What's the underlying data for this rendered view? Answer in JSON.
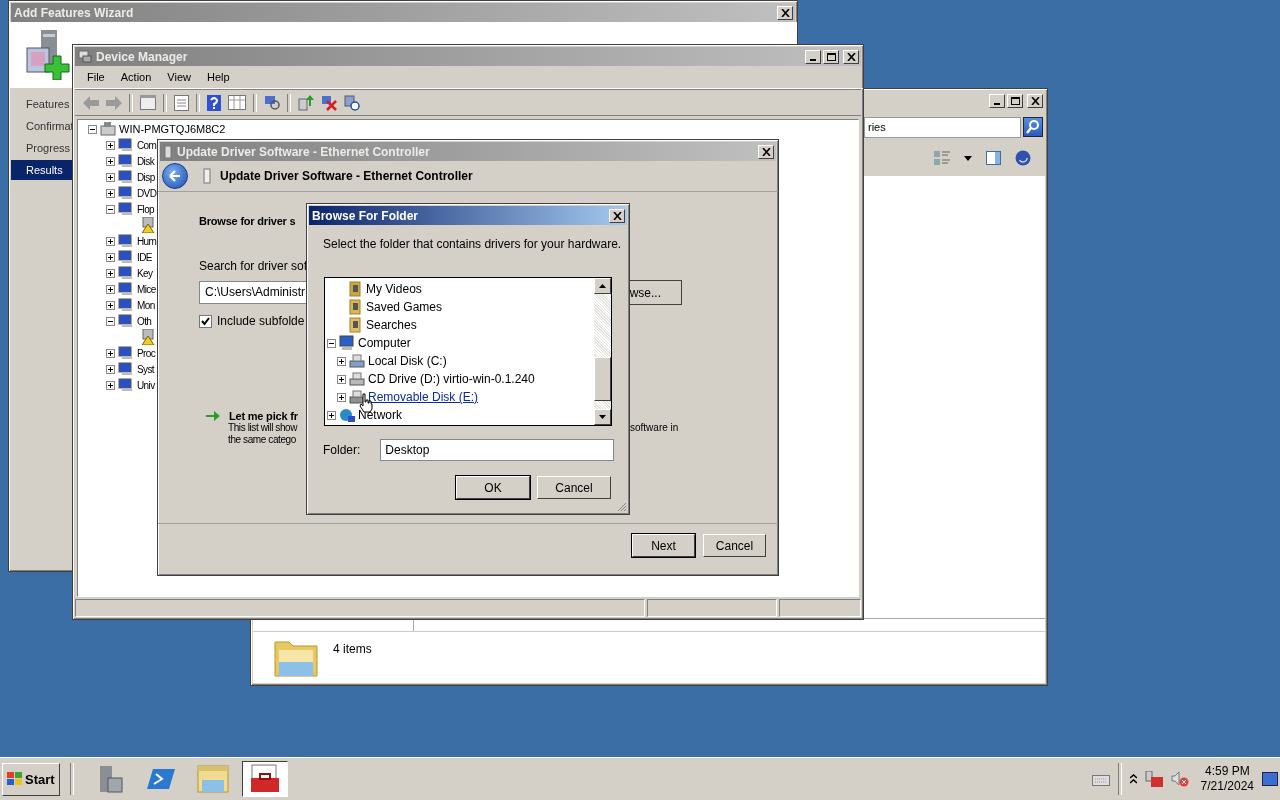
{
  "wizard": {
    "title": "Add Features Wizard",
    "steps": [
      {
        "label": "Features",
        "selected": false
      },
      {
        "label": "Confirmat",
        "selected": false
      },
      {
        "label": "Progress",
        "selected": false
      },
      {
        "label": "Results",
        "selected": true
      }
    ]
  },
  "explorer": {
    "search_value": "ries",
    "status": "4 items"
  },
  "device_manager": {
    "title": "Device Manager",
    "menu": [
      "File",
      "Action",
      "View",
      "Help"
    ],
    "tree": {
      "label": "WIN-PMGTQJ6M8C2",
      "expanded": true,
      "children": [
        {
          "label": "Com",
          "expanded": false
        },
        {
          "label": "Disk",
          "expanded": false
        },
        {
          "label": "Disp",
          "expanded": false
        },
        {
          "label": "DVD",
          "expanded": false
        },
        {
          "label": "Flop",
          "expanded": true,
          "children": [
            {
              "warning": true
            }
          ]
        },
        {
          "label": "Hum",
          "expanded": false
        },
        {
          "label": "IDE",
          "expanded": false
        },
        {
          "label": "Key",
          "expanded": false
        },
        {
          "label": "Mice",
          "expanded": false
        },
        {
          "label": "Mon",
          "expanded": false
        },
        {
          "label": "Oth",
          "expanded": true,
          "children": [
            {
              "warning": true
            }
          ]
        },
        {
          "label": "Proc",
          "expanded": false
        },
        {
          "label": "Syst",
          "expanded": false
        },
        {
          "label": "Univ",
          "expanded": false
        }
      ]
    }
  },
  "update_driver": {
    "title": "Update Driver Software - Ethernet Controller",
    "header": "Update Driver Software - Ethernet Controller",
    "heading": "Browse for driver s",
    "search_label": "Search for driver sof",
    "path_value": "C:\\Users\\Administr",
    "browse_button": "wse...",
    "include_subfolders": {
      "label": "Include subfolde",
      "checked": true
    },
    "pick_link": "Let me pick fr",
    "pick_description": [
      "This list will show",
      "the same catego"
    ],
    "pick_description_right": "software in",
    "buttons": [
      "Next",
      "Cancel"
    ]
  },
  "browse_dialog": {
    "title": "Browse For Folder",
    "prompt": "Select the folder that contains drivers for your hardware.",
    "tree": [
      {
        "label": "My Videos",
        "kind": "videos"
      },
      {
        "label": "Saved Games",
        "kind": "games"
      },
      {
        "label": "Searches",
        "kind": "search"
      },
      {
        "label": "Computer",
        "kind": "computer",
        "expanded": true,
        "children": [
          {
            "label": "Local Disk (C:)",
            "kind": "disk",
            "expanded": false,
            "hovered": false
          },
          {
            "label": "CD Drive (D:) virtio-win-0.1.240",
            "kind": "cd",
            "expanded": false,
            "hovered": false
          },
          {
            "label": "Removable Disk (E:)",
            "kind": "removable",
            "expanded": false,
            "hovered": true
          }
        ]
      },
      {
        "label": "Network",
        "kind": "network",
        "expanded": false
      }
    ],
    "folder_label": "Folder:",
    "folder_value": "Desktop",
    "buttons": [
      "OK",
      "Cancel"
    ]
  },
  "taskbar": {
    "start": "Start",
    "apps": [
      {
        "kind": "server",
        "selected": false
      },
      {
        "kind": "powershell",
        "selected": false
      },
      {
        "kind": "explorer",
        "selected": false
      },
      {
        "kind": "toolbox",
        "selected": true
      }
    ],
    "time": "4:59 PM",
    "date": "7/21/2024"
  }
}
